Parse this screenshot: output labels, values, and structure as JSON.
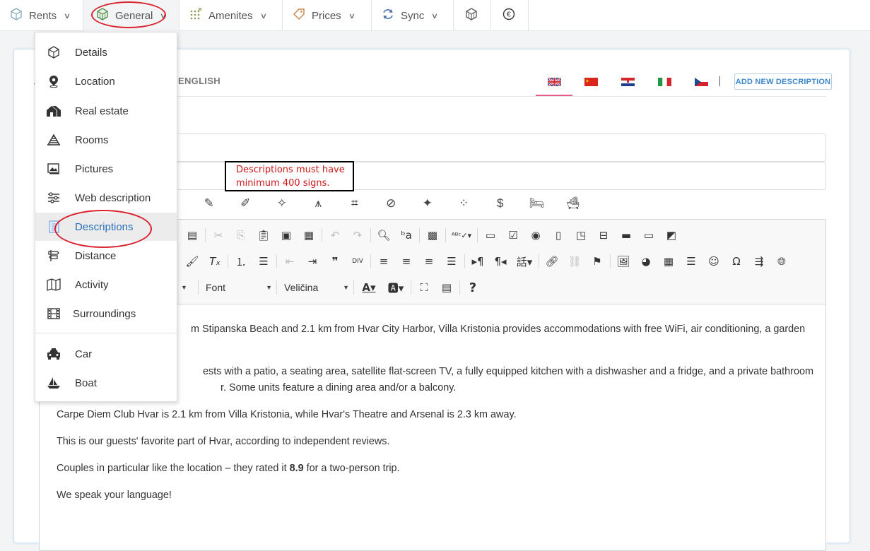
{
  "nav": {
    "rents": "Rents",
    "general": "General",
    "amenites": "Amenites",
    "prices": "Prices",
    "sync": "Sync"
  },
  "card": {
    "language_title": "ENGLISH",
    "add_button": "ADD NEW DESCRIPTION",
    "flags": [
      "uk-flag",
      "china-flag",
      "croatia-flag",
      "italy-flag",
      "czech-flag"
    ]
  },
  "callout": {
    "line1": "Descriptions must have",
    "line2": "minimum 400 signs."
  },
  "toolbar": {
    "font_label": "Font",
    "size_label": "Veličina"
  },
  "menu": {
    "items": [
      {
        "label": "Details"
      },
      {
        "label": "Location"
      },
      {
        "label": "Real estate"
      },
      {
        "label": "Rooms"
      },
      {
        "label": "Pictures"
      },
      {
        "label": "Web description"
      },
      {
        "label": "Descriptions"
      },
      {
        "label": "Distance"
      },
      {
        "label": "Activity"
      },
      {
        "label": "Surroundings"
      },
      {
        "label": "Car"
      },
      {
        "label": "Boat"
      }
    ]
  },
  "body": {
    "p1": "m Stipanska Beach and 2.1 km from Hvar City Harbor, Villa Kristonia provides accommodations with free WiFi, air conditioning, a garden",
    "p2a": "ests with a patio, a seating area, satellite flat-screen TV, a fully equipped kitchen with a dishwasher and a fridge, and a private bathroom",
    "p2b": "r. Some units feature a dining area and/or a balcony.",
    "p3": "Carpe Diem Club Hvar is 2.1 km from Villa Kristonia, while Hvar's Theatre and Arsenal is 2.3 km away.",
    "p4": "This is our guests' favorite part of Hvar, according to independent reviews.",
    "p5_pre": "Couples in particular like the location – they rated it ",
    "p5_bold": "8.9",
    "p5_post": " for a two-person trip.",
    "p6": "We speak your language!"
  },
  "colors": {
    "accent_blue": "#3a86c8",
    "annotation_red": "#d9232e",
    "active_tab": "#e35d8c"
  }
}
